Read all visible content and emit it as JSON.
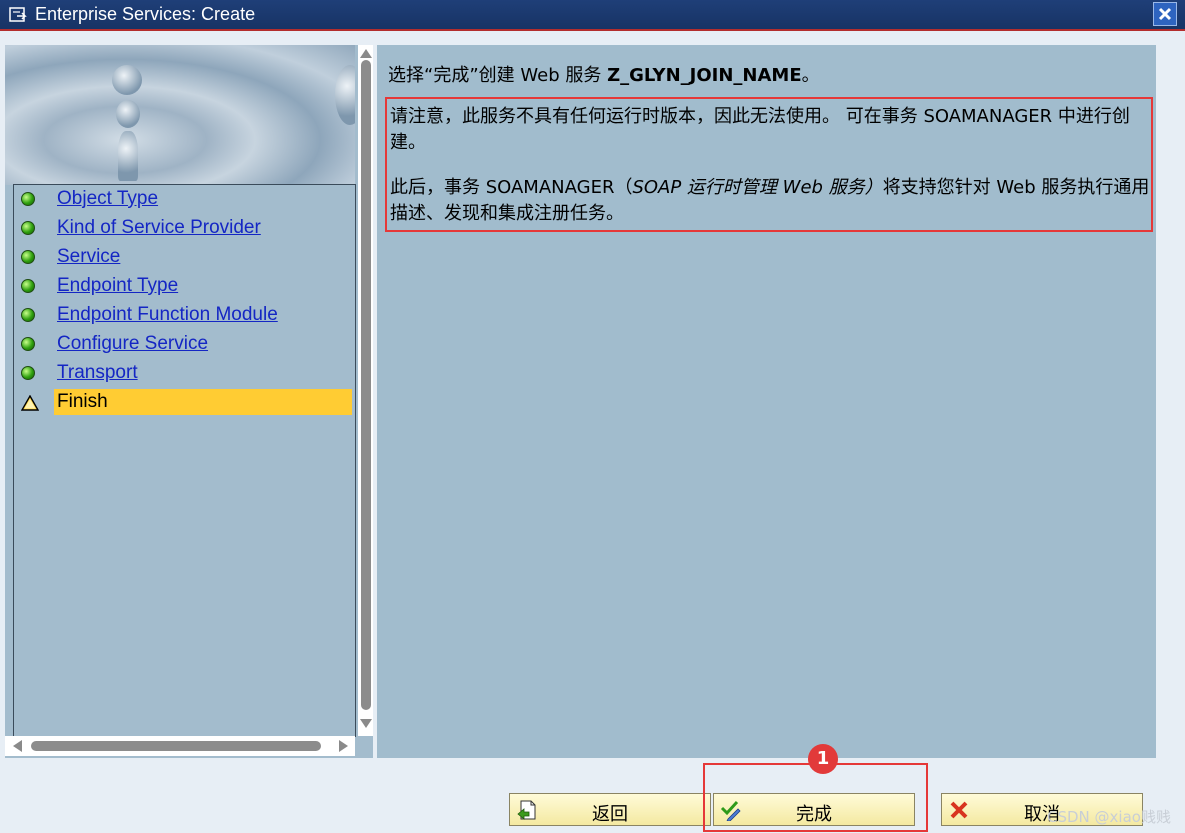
{
  "window": {
    "title": "Enterprise Services: Create",
    "close_icon": "close-icon"
  },
  "nav": {
    "items": [
      {
        "label": "Object Type",
        "status": "complete"
      },
      {
        "label": "Kind of Service Provider",
        "status": "complete"
      },
      {
        "label": "Service",
        "status": "complete"
      },
      {
        "label": "Endpoint Type",
        "status": "complete"
      },
      {
        "label": "Endpoint Function Module",
        "status": "complete"
      },
      {
        "label": "Configure Service",
        "status": "complete"
      },
      {
        "label": "Transport",
        "status": "complete"
      },
      {
        "label": "Finish",
        "status": "current"
      }
    ]
  },
  "content": {
    "intro_prefix": "选择“完成”创建 Web 服务 ",
    "service_name": "Z_GLYN_JOIN_NAME",
    "intro_suffix": "。",
    "note_paragraph1": "请注意，此服务不具有任何运行时版本，因此无法使用。 可在事务 SOAMANAGER 中进行创建。",
    "note_paragraph2_prefix": "此后，事务 SOAMANAGER（",
    "note_paragraph2_italic": "SOAP 运行时管理 Web 服务）",
    "note_paragraph2_suffix": "将支持您针对 Web 服务执行通用描述、发现和集成注册任务。"
  },
  "buttons": {
    "back": "返回",
    "finish": "完成",
    "cancel": "取消"
  },
  "annotation": {
    "callout_number": "1"
  },
  "watermark": "CSDN @xiao贱贱",
  "colors": {
    "title_bar": "#1f3f78",
    "highlight": "#ffcc33",
    "link": "#1426c4",
    "annotation_red": "#e53838",
    "panel_bg": "#a1bccd"
  }
}
